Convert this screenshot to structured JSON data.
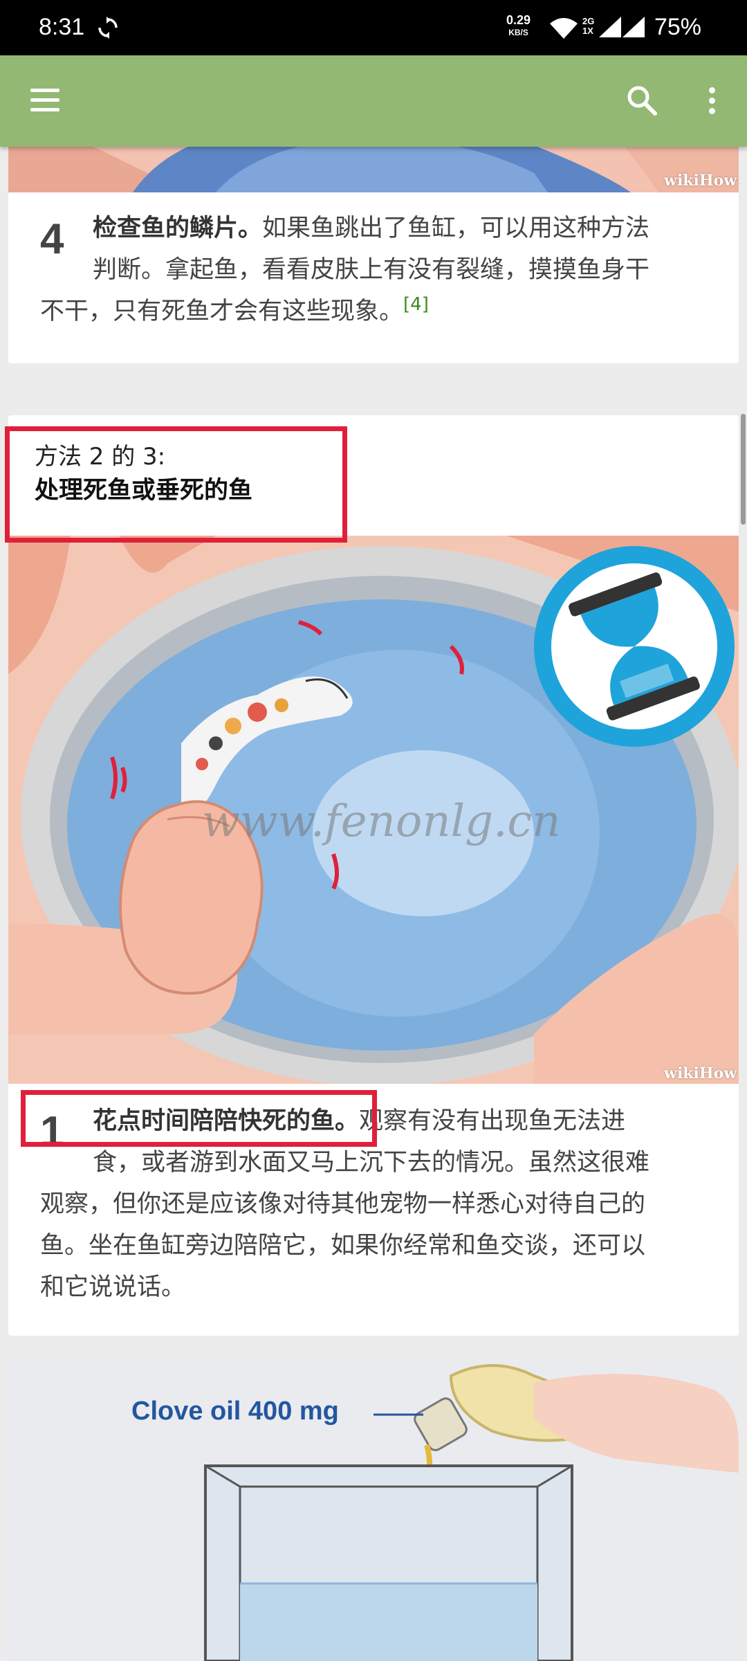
{
  "status_bar": {
    "time": "8:31",
    "net_speed_value": "0.29",
    "net_speed_unit": "KB/S",
    "signal_2g": "2G",
    "signal_1x": "1X",
    "battery": "75%"
  },
  "toolbar": {
    "menu_icon": "hamburger-menu-icon",
    "search_icon": "search-icon",
    "more_icon": "more-vertical-icon",
    "color": "#93b874"
  },
  "step4": {
    "number": "4",
    "bold": "检查鱼的鳞片。",
    "line1": "如果鱼跳出了鱼缸，可以用这种方法",
    "line2": "判断。拿起鱼，看看皮肤上有没有裂缝，摸摸鱼身干",
    "line3": "不干，只有死鱼才会有这些现象。",
    "ref": "[4]"
  },
  "method": {
    "label": "方法 2 的 3:",
    "title": "处理死鱼或垂死的鱼"
  },
  "step1": {
    "number": "1",
    "bold": "花点时间陪陪快死的鱼。",
    "line1": "观察有没有出现鱼无法进",
    "line2": "食，或者游到水面又马上沉下去的情况。虽然这很难",
    "line3": "观察，但你还是应该像对待其他宠物一样悉心对待自己的",
    "line4": "鱼。坐在鱼缸旁边陪陪它，如果你经常和鱼交谈，还可以",
    "line5": "和它说说话。"
  },
  "images": {
    "wikihow_watermark": "wikiHow",
    "site_watermark": "www.fenonlg.cn",
    "hourglass_icon": "hourglass-icon",
    "clove_label": "Clove oil 400 mg"
  },
  "colors": {
    "highlight": "#e0203a",
    "accent_blue": "#1fa3db"
  }
}
